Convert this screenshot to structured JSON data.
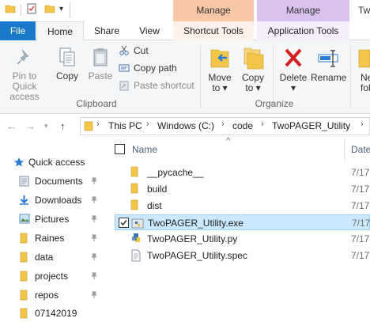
{
  "titlebar": {
    "context_tabs": {
      "manage_shortcut": "Manage",
      "manage_app": "Manage",
      "cut_off": "Tw"
    }
  },
  "tabs": {
    "file": "File",
    "home": "Home",
    "share": "Share",
    "view": "View",
    "shortcut_tools": "Shortcut Tools",
    "application_tools": "Application Tools"
  },
  "ribbon": {
    "pin_label_1": "Pin to Quick",
    "pin_label_2": "access",
    "copy": "Copy",
    "paste": "Paste",
    "cut": "Cut",
    "copy_path": "Copy path",
    "paste_shortcut": "Paste shortcut",
    "clipboard_group": "Clipboard",
    "move_to_1": "Move",
    "move_to_2": "to",
    "copy_to_1": "Copy",
    "copy_to_2": "to",
    "delete": "Delete",
    "rename": "Rename",
    "organize_group": "Organize",
    "new_folder_1": "Ne",
    "new_folder_2": "fol"
  },
  "address": {
    "crumbs": [
      "This PC",
      "Windows (C:)",
      "code",
      "TwoPAGER_Utility"
    ]
  },
  "nav": {
    "quick_access": "Quick access",
    "items": [
      "Documents",
      "Downloads",
      "Pictures",
      "Raines",
      "data",
      "projects",
      "repos",
      "07142019"
    ]
  },
  "files": {
    "col_name": "Name",
    "col_date": "Date",
    "rows": [
      {
        "name": "__pycache__",
        "date": "7/17",
        "type": "folder"
      },
      {
        "name": "build",
        "date": "7/17",
        "type": "folder"
      },
      {
        "name": "dist",
        "date": "7/17",
        "type": "folder"
      },
      {
        "name": "TwoPAGER_Utility.exe",
        "date": "7/17",
        "type": "exe",
        "selected": true
      },
      {
        "name": "TwoPAGER_Utility.py",
        "date": "7/17",
        "type": "py"
      },
      {
        "name": "TwoPAGER_Utility.spec",
        "date": "7/17",
        "type": "spec"
      }
    ]
  },
  "colors": {
    "file_tab": "#1979ca",
    "manage_shortcut": "#f8c8a6",
    "manage_app": "#d9c3ee",
    "selection": "#cce8ff",
    "folder": "#f3c64a"
  }
}
